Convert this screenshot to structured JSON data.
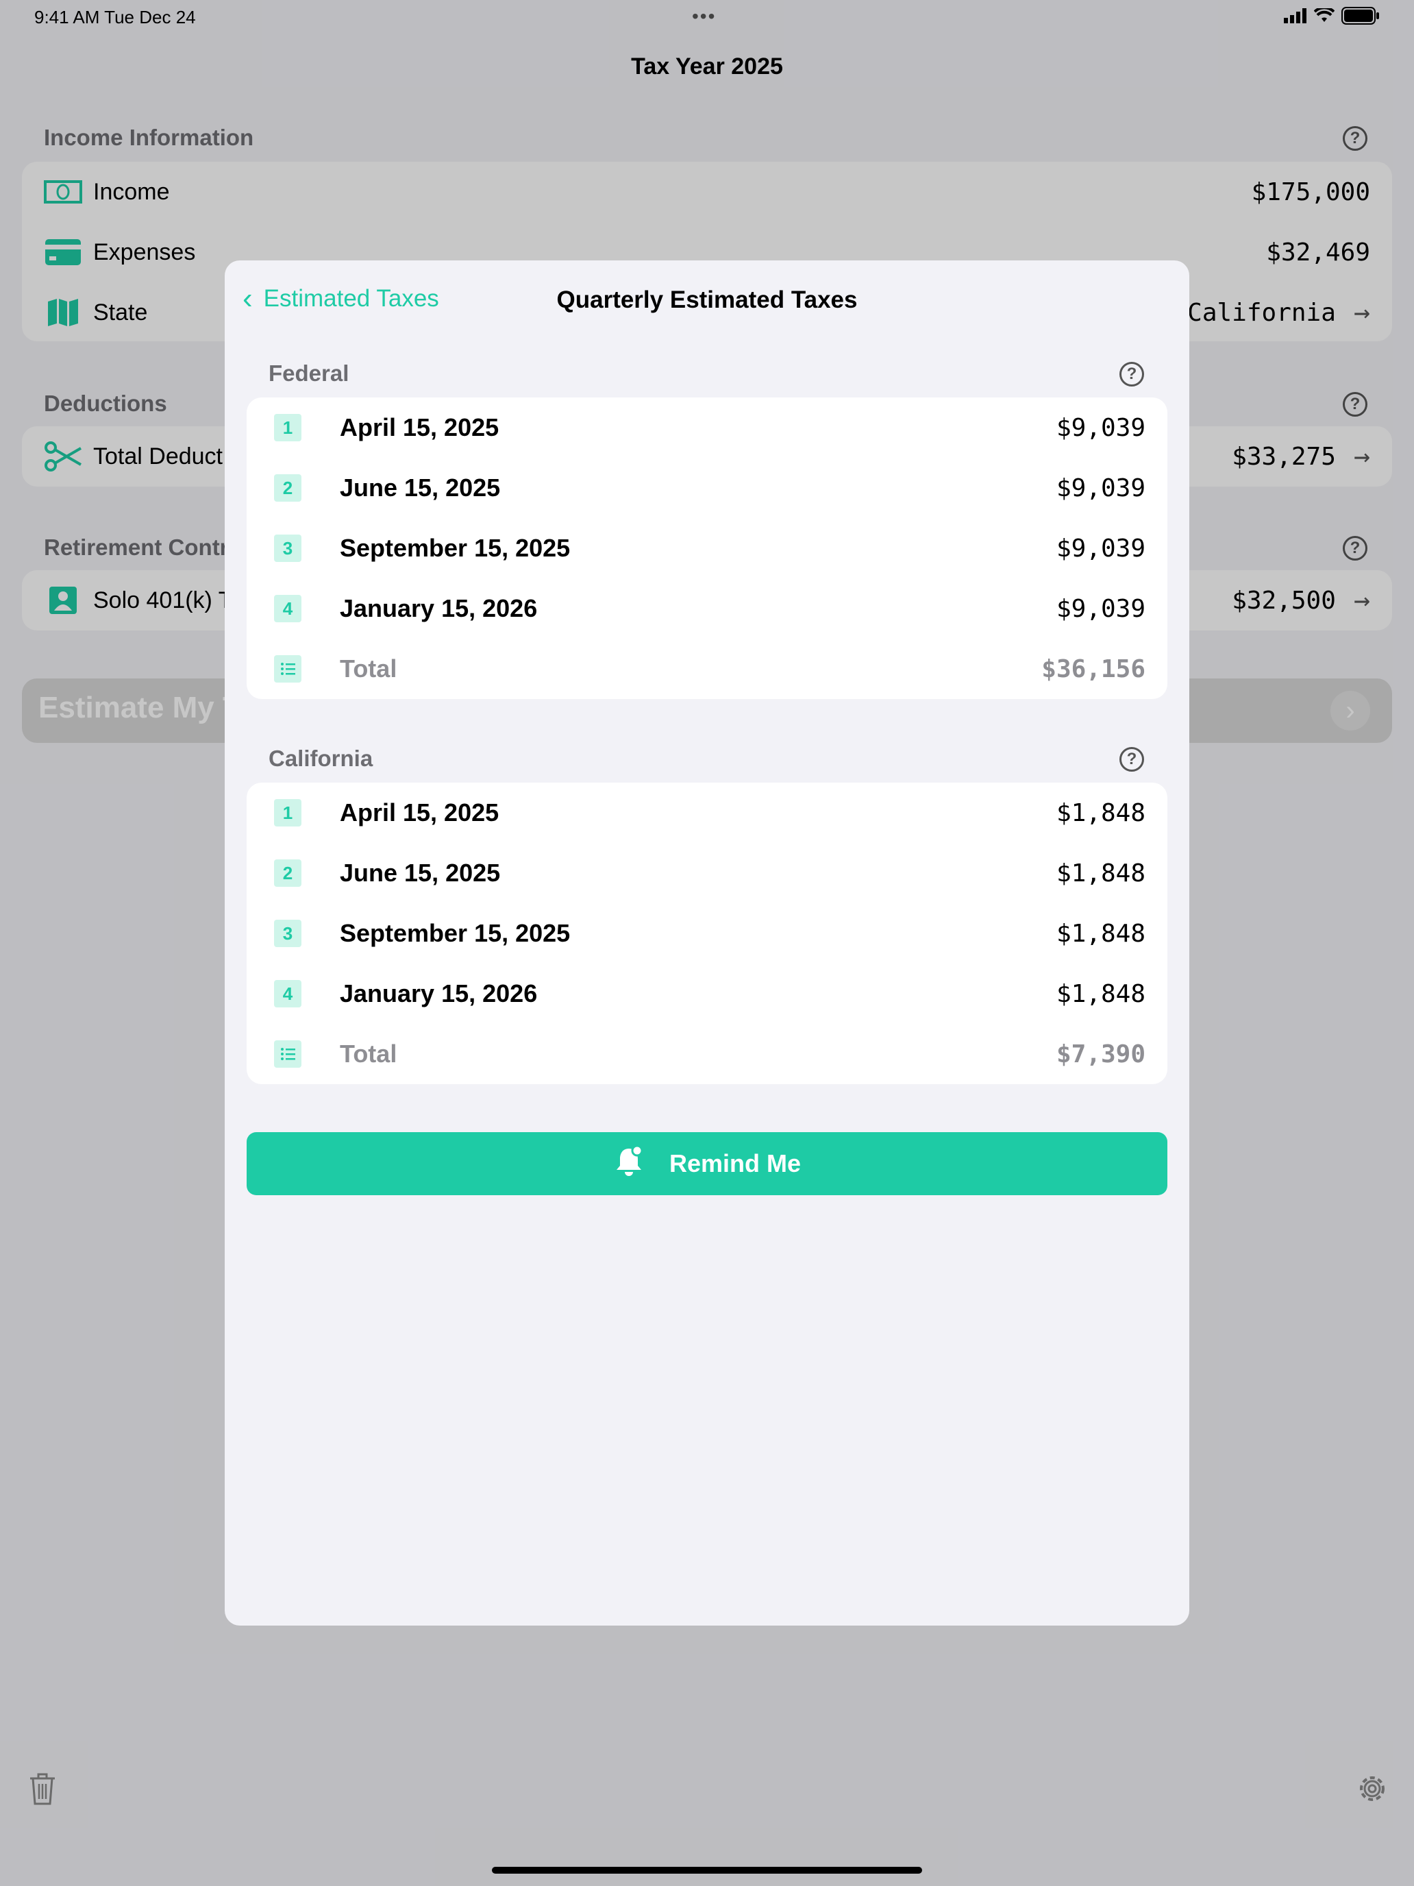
{
  "status_bar": {
    "time": "9:41 AM",
    "date": "Tue Dec 24",
    "dots": "•••"
  },
  "background": {
    "title": "Tax Year 2025",
    "income_section": {
      "header": "Income Information",
      "rows": [
        {
          "label": "Income",
          "value": "$175,000",
          "icon": "banknote-icon"
        },
        {
          "label": "Expenses",
          "value": "$32,469",
          "icon": "credit-card-icon"
        },
        {
          "label": "State",
          "value": "California",
          "icon": "map-icon"
        }
      ]
    },
    "deductions_section": {
      "header": "Deductions",
      "row": {
        "label": "Total Deduct",
        "value": "$33,275",
        "icon": "scissors-icon"
      }
    },
    "retirement_section": {
      "header": "Retirement Contr",
      "row": {
        "label": "Solo 401(k) T",
        "value": "$32,500",
        "icon": "person-icon"
      }
    },
    "estimate_button": "Estimate My T",
    "toolbar": {
      "left_icon": "trash-icon",
      "right_icon": "gear-icon"
    }
  },
  "modal": {
    "back_label": "Estimated Taxes",
    "title": "Quarterly Estimated Taxes",
    "federal": {
      "header": "Federal",
      "rows": [
        {
          "num": "1",
          "date": "April 15, 2025",
          "amount": "$9,039"
        },
        {
          "num": "2",
          "date": "June 15, 2025",
          "amount": "$9,039"
        },
        {
          "num": "3",
          "date": "September 15, 2025",
          "amount": "$9,039"
        },
        {
          "num": "4",
          "date": "January 15, 2026",
          "amount": "$9,039"
        }
      ],
      "total_label": "Total",
      "total": "$36,156"
    },
    "california": {
      "header": "California",
      "rows": [
        {
          "num": "1",
          "date": "April 15, 2025",
          "amount": "$1,848"
        },
        {
          "num": "2",
          "date": "June 15, 2025",
          "amount": "$1,848"
        },
        {
          "num": "3",
          "date": "September 15, 2025",
          "amount": "$1,848"
        },
        {
          "num": "4",
          "date": "January 15, 2026",
          "amount": "$1,848"
        }
      ],
      "total_label": "Total",
      "total": "$7,390"
    },
    "remind_button": "Remind Me"
  },
  "colors": {
    "accent": "#1ecba5",
    "badge_bg": "#cff5ea"
  }
}
